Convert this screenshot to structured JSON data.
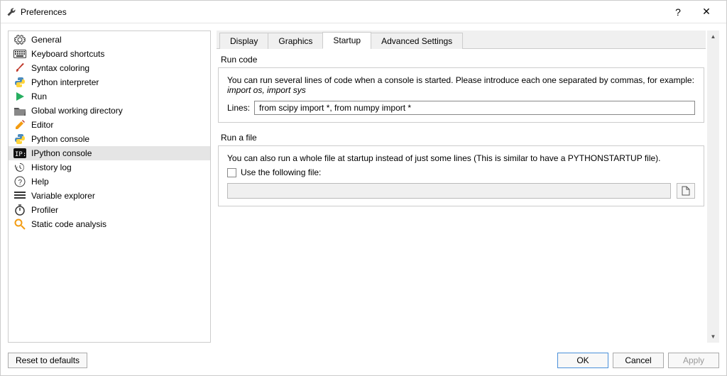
{
  "window": {
    "title": "Preferences",
    "help": "?",
    "close": "✕"
  },
  "sidebar": {
    "items": [
      {
        "icon": "gear",
        "label": "General"
      },
      {
        "icon": "keyboard",
        "label": "Keyboard shortcuts"
      },
      {
        "icon": "brush",
        "label": "Syntax coloring"
      },
      {
        "icon": "python",
        "label": "Python interpreter"
      },
      {
        "icon": "play",
        "label": "Run"
      },
      {
        "icon": "folder",
        "label": "Global working directory"
      },
      {
        "icon": "pencil",
        "label": "Editor"
      },
      {
        "icon": "python",
        "label": "Python console"
      },
      {
        "icon": "ip",
        "label": "IPython console"
      },
      {
        "icon": "history",
        "label": "History log"
      },
      {
        "icon": "help",
        "label": "Help"
      },
      {
        "icon": "list",
        "label": "Variable explorer"
      },
      {
        "icon": "timer",
        "label": "Profiler"
      },
      {
        "icon": "magnify",
        "label": "Static code analysis"
      }
    ],
    "selected_index": 8
  },
  "tabs": {
    "items": [
      "Display",
      "Graphics",
      "Startup",
      "Advanced Settings"
    ],
    "active_index": 2
  },
  "run_code": {
    "title": "Run code",
    "desc1": "You can run several lines of code when a console is started. Please introduce each one separated by commas, for example:",
    "desc2": "import os, import sys",
    "lines_label": "Lines:",
    "lines_value": "from scipy import *, from numpy import *"
  },
  "run_file": {
    "title": "Run a file",
    "desc": "You can also run a whole file at startup instead of just some lines (This is similar to have a PYTHONSTARTUP file).",
    "checkbox_label": "Use the following file:",
    "file_value": ""
  },
  "buttons": {
    "reset": "Reset to defaults",
    "ok": "OK",
    "cancel": "Cancel",
    "apply": "Apply"
  }
}
